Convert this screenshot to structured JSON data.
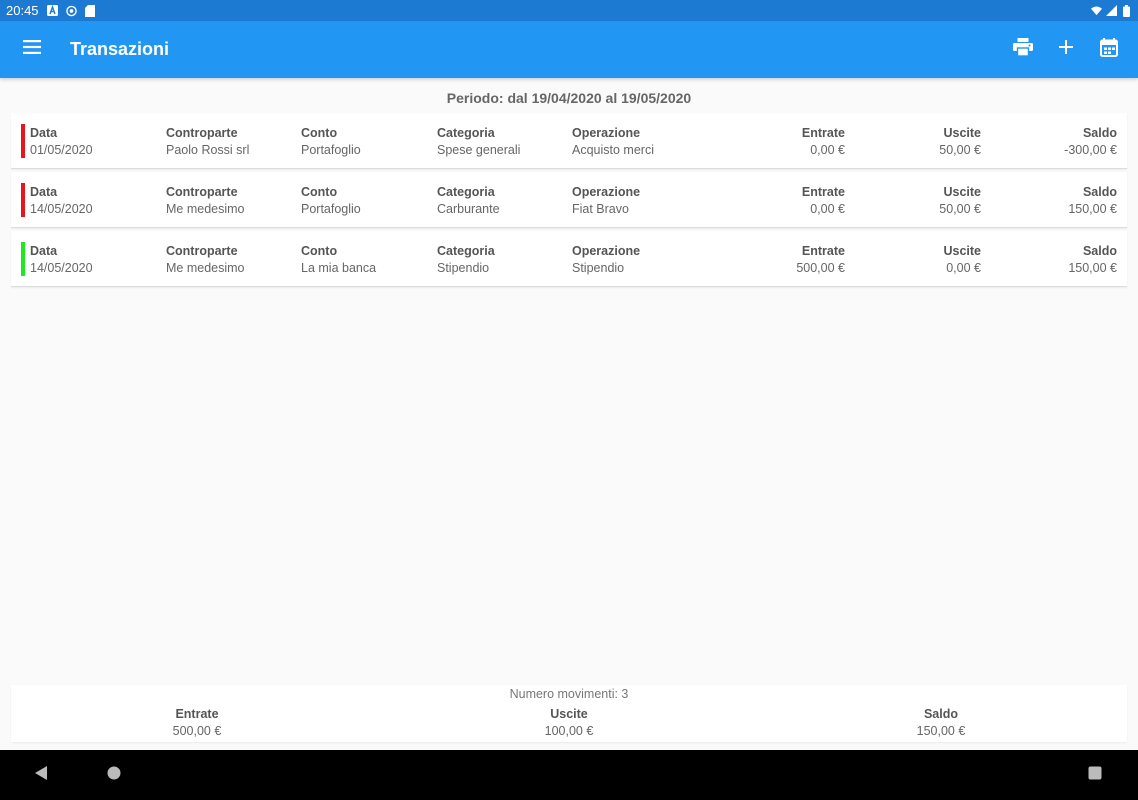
{
  "status_bar": {
    "time": "20:45"
  },
  "app_bar": {
    "title": "Transazioni"
  },
  "period": "Periodo: dal 19/04/2020 al 19/05/2020",
  "labels": {
    "data": "Data",
    "controparte": "Controparte",
    "conto": "Conto",
    "categoria": "Categoria",
    "operazione": "Operazione",
    "entrate": "Entrate",
    "uscite": "Uscite",
    "saldo": "Saldo"
  },
  "colors": {
    "expense": "#e8141e",
    "income": "#1ee81e",
    "primary": "#2196f3"
  },
  "transactions": [
    {
      "type": "expense",
      "data": "01/05/2020",
      "controparte": "Paolo Rossi srl",
      "conto": "Portafoglio",
      "categoria": "Spese generali",
      "operazione": "Acquisto merci",
      "entrate": "0,00 €",
      "uscite": "50,00 €",
      "saldo": "-300,00 €"
    },
    {
      "type": "expense",
      "data": "14/05/2020",
      "controparte": "Me medesimo",
      "conto": "Portafoglio",
      "categoria": "Carburante",
      "operazione": "Fiat Bravo",
      "entrate": "0,00 €",
      "uscite": "50,00 €",
      "saldo": "150,00 €"
    },
    {
      "type": "income",
      "data": "14/05/2020",
      "controparte": "Me medesimo",
      "conto": "La mia banca",
      "categoria": "Stipendio",
      "operazione": "Stipendio",
      "entrate": "500,00 €",
      "uscite": "0,00 €",
      "saldo": "150,00 €"
    }
  ],
  "summary": {
    "count": "Numero movimenti: 3",
    "entrate_label": "Entrate",
    "entrate": "500,00 €",
    "uscite_label": "Uscite",
    "uscite": "100,00 €",
    "saldo_label": "Saldo",
    "saldo": "150,00 €"
  },
  "icons": {
    "menu": "menu-icon",
    "print": "print-icon",
    "add": "add-icon",
    "calendar": "calendar-icon",
    "back": "back-icon",
    "home": "home-icon",
    "recents": "recents-icon"
  }
}
